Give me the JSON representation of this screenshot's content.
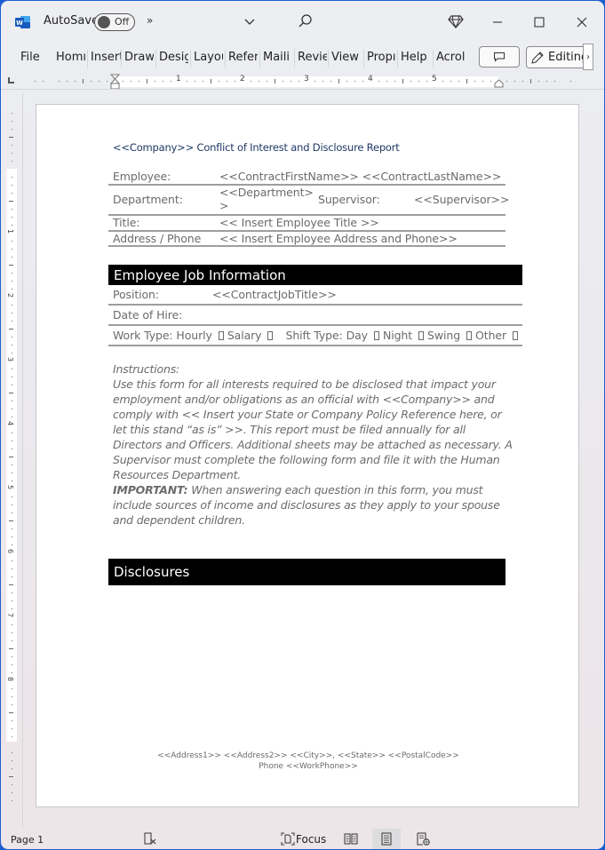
{
  "titlebar": {
    "autosave_label": "AutoSave",
    "autosave_state": "Off",
    "more_commands": "»",
    "qa_dropdown": "⌄",
    "icons": [
      "word-logo-icon",
      "search-icon",
      "diamond-icon",
      "minimize-icon",
      "maximize-icon",
      "close-icon"
    ]
  },
  "ribbon": {
    "tabs": [
      "File",
      "Home",
      "Insert",
      "Draw",
      "Design",
      "Layout",
      "References",
      "Mailings",
      "Review",
      "View",
      "Properties",
      "Help",
      "Acrobat"
    ],
    "tabs_visible": [
      "File",
      "Homı",
      "Insert",
      "Draw",
      "Desig",
      "Layou",
      "Refer",
      "Maili",
      "Revie",
      "View",
      "Propı",
      "Help",
      "Acrol"
    ],
    "editing_label": "Editing",
    "scroll_arrow": "›"
  },
  "ruler": {
    "numbers": [
      "1",
      "2",
      "3",
      "4",
      "5"
    ],
    "vertical_numbers": [
      "1",
      "2",
      "3",
      "4",
      "5",
      "6",
      "7",
      "8"
    ]
  },
  "document": {
    "title": "<<Company>> Conflict of Interest and Disclosure Report",
    "employee_table": {
      "employee_label": "Employee:",
      "employee_value": "<<ContractFirstName>> <<ContractLastName>>",
      "department_label": "Department:",
      "department_value_line1": "<<Department>",
      "department_value_line2": ">",
      "supervisor_label": "Supervisor:",
      "supervisor_value": "<<Supervisor>>",
      "title_label": "Title:",
      "title_value": "<< Insert Employee Title >>",
      "address_label": "Address / Phone",
      "address_value": "<< Insert Employee Address and Phone>>"
    },
    "job_section": {
      "heading": "Employee Job Information",
      "position_label": "Position:",
      "position_value": "<<ContractJobTitle>>",
      "hire_label": "Date of Hire:",
      "work_type_label": "Work Type: Hourly",
      "salary_label": "Salary",
      "shift_type_label": "Shift Type: Day",
      "night_label": "Night",
      "swing_label": "Swing",
      "other_label": "Other"
    },
    "instructions": {
      "heading": "Instructions:",
      "body": "Use this form for all interests required to be disclosed that impact your employment and/or obligations as an official with <<Company>> and comply with << Insert your State or Company Policy Reference here, or let this stand “as is” >>. This report must be filed annually for all Directors and Officers. Additional sheets may be attached as necessary. A Supervisor must complete the following form and file it with the Human Resources Department.",
      "important_label": "IMPORTANT:",
      "important_body": " When answering each question in this form, you must include sources of income and disclosures as they apply to your spouse and dependent children."
    },
    "disclosures_heading": "Disclosures",
    "footer": {
      "address_line": "<<Address1>> <<Address2>> <<City>>, <<State>> <<PostalCode>>",
      "phone_line": "Phone <<WorkPhone>>"
    }
  },
  "statusbar": {
    "page": "Page 1",
    "focus_label": "Focus",
    "icons": [
      "track-changes-icon",
      "focus-icon",
      "read-mode-icon",
      "print-layout-icon",
      "web-layout-icon"
    ]
  }
}
